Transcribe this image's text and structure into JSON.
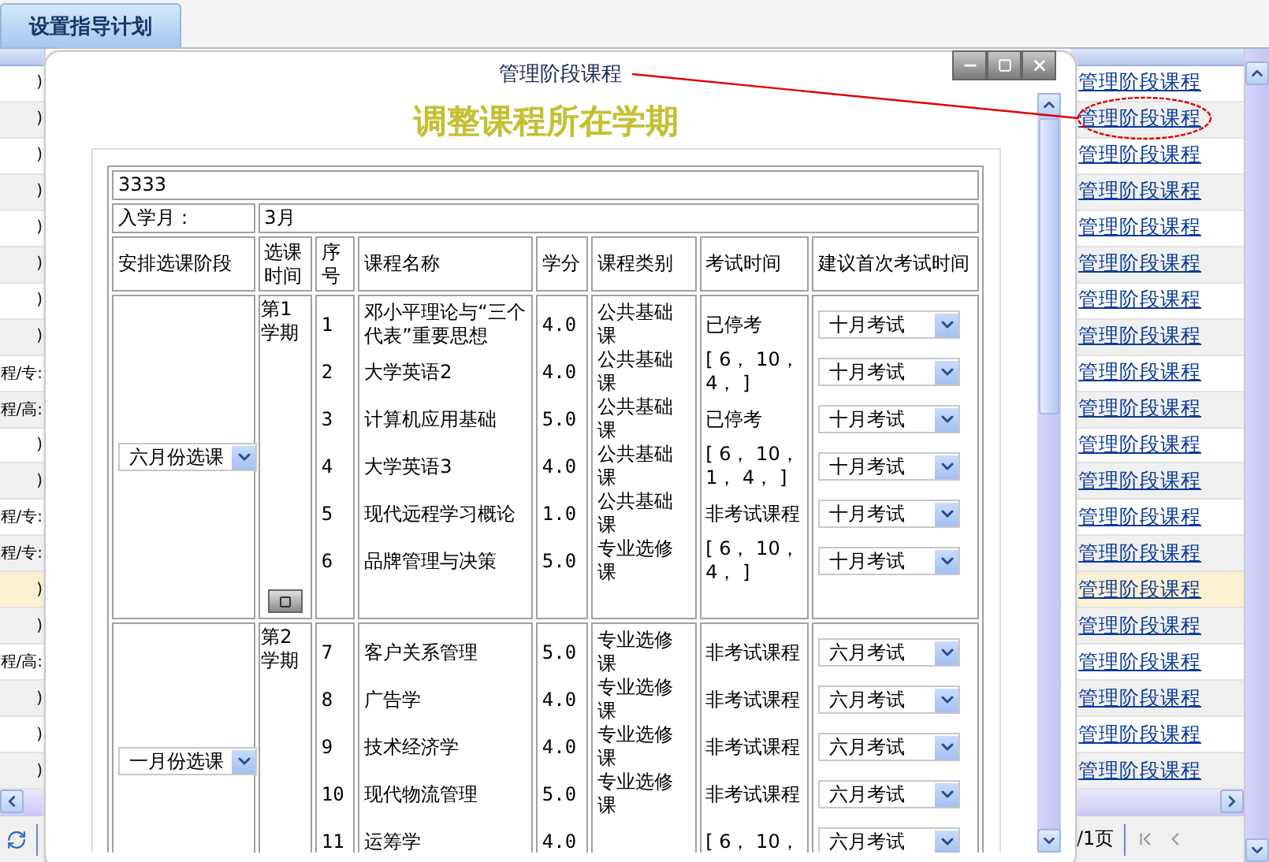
{
  "tabs": [
    {
      "label": "设置指导计划",
      "selected": true
    }
  ],
  "list": {
    "rows": [
      {
        "left_text": ")",
        "action": "管理阶段课程",
        "selected": false
      },
      {
        "left_text": ")",
        "action": "管理阶段课程",
        "selected": false
      },
      {
        "left_text": ")",
        "action": "管理阶段课程",
        "selected": false
      },
      {
        "left_text": ")",
        "action": "管理阶段课程",
        "selected": false
      },
      {
        "left_text": ")",
        "action": "管理阶段课程",
        "selected": false
      },
      {
        "left_text": ")",
        "action": "管理阶段课程",
        "selected": false
      },
      {
        "left_text": ")",
        "action": "管理阶段课程",
        "selected": false
      },
      {
        "left_text": ")",
        "action": "管理阶段课程",
        "selected": false
      },
      {
        "left_text": "程/专:",
        "action": "管理阶段课程",
        "selected": false
      },
      {
        "left_text": "程/高:",
        "action": "管理阶段课程",
        "selected": false
      },
      {
        "left_text": ")",
        "action": "管理阶段课程",
        "selected": false
      },
      {
        "left_text": ")",
        "action": "管理阶段课程",
        "selected": false
      },
      {
        "left_text": "程/专:",
        "action": "管理阶段课程",
        "selected": false
      },
      {
        "left_text": "程/专:",
        "action": "管理阶段课程",
        "selected": false
      },
      {
        "left_text": ")",
        "action": "管理阶段课程",
        "selected": true
      },
      {
        "left_text": ")",
        "action": "管理阶段课程",
        "selected": false
      },
      {
        "left_text": "程/高:",
        "action": "管理阶段课程",
        "selected": false
      },
      {
        "left_text": ")",
        "action": "管理阶段课程",
        "selected": false
      },
      {
        "left_text": ")",
        "action": "管理阶段课程",
        "selected": false
      },
      {
        "left_text": ")",
        "action": "管理阶段课程",
        "selected": false
      }
    ]
  },
  "pager": {
    "page_text": "/1页"
  },
  "dialog": {
    "title": "管理阶段课程",
    "heading": "调整课程所在学期",
    "student": "3333",
    "enroll_label": "入学月：",
    "enroll_value": "3月",
    "columns": [
      "安排选课阶段",
      "选课时间",
      "序号",
      "课程名称",
      "学分",
      "课程类别",
      "考试时间",
      "建议首次考试时间"
    ],
    "groups": [
      {
        "stage": "六月份选课",
        "term": "第1学期",
        "button": true,
        "courses": [
          {
            "no": "1",
            "name": "邓小平理论与“三个代表”重要思想",
            "credits": "4.0",
            "category": "公共基础课",
            "exam": "已停考",
            "first_exam": "十月考试"
          },
          {
            "no": "2",
            "name": "大学英语2",
            "credits": "4.0",
            "category": "公共基础课",
            "exam": "[ 6， 10， 4， ]",
            "first_exam": "十月考试"
          },
          {
            "no": "3",
            "name": "计算机应用基础",
            "credits": "5.0",
            "category": "公共基础课",
            "exam": "已停考",
            "first_exam": "十月考试"
          },
          {
            "no": "4",
            "name": "大学英语3",
            "credits": "4.0",
            "category": "公共基础课",
            "exam": "[ 6， 10， 1， 4， ]",
            "first_exam": "十月考试"
          },
          {
            "no": "5",
            "name": "现代远程学习概论",
            "credits": "1.0",
            "category": "公共基础课",
            "exam": "非考试课程",
            "first_exam": "十月考试"
          },
          {
            "no": "6",
            "name": "品牌管理与决策",
            "credits": "5.0",
            "category": "专业选修课",
            "exam": "[ 6， 10， 4， ]",
            "first_exam": "十月考试"
          }
        ]
      },
      {
        "stage": "一月份选课",
        "term": "第2学期",
        "button": false,
        "courses": [
          {
            "no": "7",
            "name": "客户关系管理",
            "credits": "5.0",
            "category": "专业选修课",
            "exam": "非考试课程",
            "first_exam": "六月考试"
          },
          {
            "no": "8",
            "name": "广告学",
            "credits": "4.0",
            "category": "专业选修课",
            "exam": "非考试课程",
            "first_exam": "六月考试"
          },
          {
            "no": "9",
            "name": "技术经济学",
            "credits": "4.0",
            "category": "专业选修课",
            "exam": "非考试课程",
            "first_exam": "六月考试"
          },
          {
            "no": "10",
            "name": "现代物流管理",
            "credits": "5.0",
            "category": "专业选修课",
            "exam": "非考试课程",
            "first_exam": "六月考试"
          },
          {
            "no": "11",
            "name": "运筹学",
            "credits": "4.0",
            "exam": "[ 6， 10，",
            "first_exam": "六月考试"
          }
        ]
      }
    ]
  }
}
